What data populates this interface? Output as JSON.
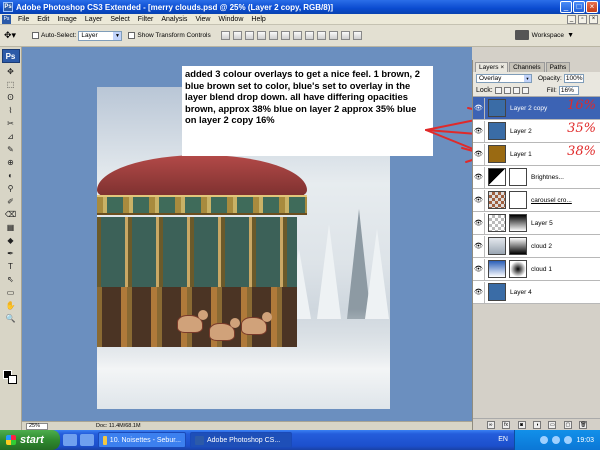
{
  "window": {
    "title": "Adobe Photoshop CS3 Extended - [merry clouds.psd @ 25% (Layer 2 copy, RGB/8)]",
    "app_icon": "Ps"
  },
  "menu": [
    "File",
    "Edit",
    "Image",
    "Layer",
    "Select",
    "Filter",
    "Analysis",
    "View",
    "Window",
    "Help"
  ],
  "options": {
    "auto_select_label": "Auto-Select:",
    "auto_select_value": "Layer",
    "transform_label": "Show Transform Controls",
    "workspace_label": "Workspace"
  },
  "tools": {
    "logo": "Ps",
    "glyphs": [
      "✥",
      "⬚",
      "ʘ",
      "⌇",
      "✂",
      "⊿",
      "✎",
      "⊕",
      "◐",
      "⚲",
      "✐",
      "⌫",
      "▦",
      "◆",
      "✒",
      "T",
      "⇖",
      "▭",
      "✋",
      "🔍"
    ]
  },
  "annotation": {
    "text": "added 3 colour overlays to get a nice feel. 1 brown, 2 blue brown set to color, blue's set to overlay in the layer blend drop down. all have differing opacities brown, approx 38%  blue on layer 2 approx 35% blue on layer 2 copy 16%",
    "arrow_color": "#e02a2a"
  },
  "status": {
    "zoom": "25%",
    "doc_info": "Doc: 11.4M/68.1M"
  },
  "layers_panel": {
    "tabs": [
      "Layers ×",
      "Channels",
      "Paths"
    ],
    "blend_mode": "Overlay",
    "opacity_label": "Opacity:",
    "opacity_value": "100%",
    "lock_label": "Lock:",
    "fill_label": "Fill:",
    "fill_value": "16%",
    "layers": [
      {
        "name": "Layer 2 copy",
        "thumb": "#3a6ca6",
        "selected": true,
        "handwritten": "16%",
        "has_mask": false
      },
      {
        "name": "Layer 2",
        "thumb": "#3a6ca6",
        "selected": false,
        "handwritten": "35%",
        "has_mask": false
      },
      {
        "name": "Layer 1",
        "thumb": "#9a6a12",
        "selected": false,
        "handwritten": "38%",
        "has_mask": false
      },
      {
        "name": "Brightnes...",
        "thumb": "adjust",
        "selected": false,
        "handwritten": "",
        "has_mask": true
      },
      {
        "name": "carousel cro...",
        "thumb": "checker",
        "selected": false,
        "handwritten": "",
        "has_mask": true
      },
      {
        "name": "Layer 5",
        "thumb": "checker",
        "selected": false,
        "handwritten": "",
        "has_mask": true
      },
      {
        "name": "cloud 2",
        "thumb": "cloud",
        "selected": false,
        "handwritten": "",
        "has_mask": true
      },
      {
        "name": "cloud 1",
        "thumb": "sky",
        "selected": false,
        "handwritten": "",
        "has_mask": true
      },
      {
        "name": "Layer 4",
        "thumb": "#3a6ca6",
        "selected": false,
        "handwritten": "",
        "has_mask": false
      }
    ],
    "footer_icons": [
      "link-icon",
      "fx-icon",
      "mask-icon",
      "adjustment-icon",
      "folder-icon",
      "new-layer-icon",
      "trash-icon"
    ],
    "footer_glyphs": [
      "∞",
      "fx",
      "◙",
      "◑",
      "▭",
      "▢",
      "🗑"
    ]
  },
  "taskbar": {
    "start_label": "start",
    "tasks": [
      "10. Noisettes - Sebur...",
      "Adobe Photoshop CS..."
    ],
    "language": "EN",
    "clock": "19:03"
  }
}
